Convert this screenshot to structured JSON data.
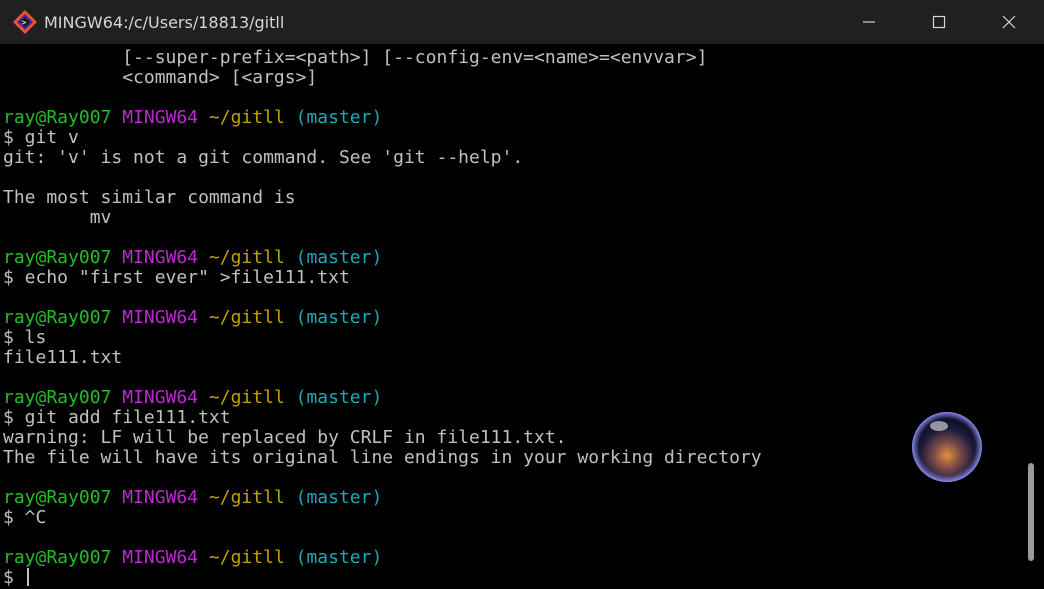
{
  "window": {
    "title": "MINGW64:/c/Users/18813/gitll",
    "icon": "git-bash-icon",
    "controls": [
      "minimize-icon",
      "maximize-icon",
      "close-icon"
    ]
  },
  "terminal": {
    "lines": [
      {
        "type": "text",
        "text": "           [--super-prefix=<path>] [--config-env=<name>=<envvar>]"
      },
      {
        "type": "text",
        "text": "           <command> [<args>]"
      },
      {
        "type": "text",
        "text": ""
      },
      {
        "type": "prompt",
        "user": "ray@Ray007",
        "host": "MINGW64",
        "path": "~/gitll",
        "branch": "(master)"
      },
      {
        "type": "text",
        "text": "$ git v"
      },
      {
        "type": "text",
        "text": "git: 'v' is not a git command. See 'git --help'."
      },
      {
        "type": "text",
        "text": ""
      },
      {
        "type": "text",
        "text": "The most similar command is"
      },
      {
        "type": "text",
        "text": "        mv"
      },
      {
        "type": "text",
        "text": ""
      },
      {
        "type": "prompt",
        "user": "ray@Ray007",
        "host": "MINGW64",
        "path": "~/gitll",
        "branch": "(master)"
      },
      {
        "type": "text",
        "text": "$ echo \"first ever\" >file111.txt"
      },
      {
        "type": "text",
        "text": ""
      },
      {
        "type": "prompt",
        "user": "ray@Ray007",
        "host": "MINGW64",
        "path": "~/gitll",
        "branch": "(master)"
      },
      {
        "type": "text",
        "text": "$ ls"
      },
      {
        "type": "text",
        "text": "file111.txt"
      },
      {
        "type": "text",
        "text": ""
      },
      {
        "type": "prompt",
        "user": "ray@Ray007",
        "host": "MINGW64",
        "path": "~/gitll",
        "branch": "(master)"
      },
      {
        "type": "text",
        "text": "$ git add file111.txt"
      },
      {
        "type": "text",
        "text": "warning: LF will be replaced by CRLF in file111.txt."
      },
      {
        "type": "text",
        "text": "The file will have its original line endings in your working directory"
      },
      {
        "type": "text",
        "text": ""
      },
      {
        "type": "prompt",
        "user": "ray@Ray007",
        "host": "MINGW64",
        "path": "~/gitll",
        "branch": "(master)"
      },
      {
        "type": "text",
        "text": "$ ^C"
      },
      {
        "type": "text",
        "text": ""
      },
      {
        "type": "prompt",
        "user": "ray@Ray007",
        "host": "MINGW64",
        "path": "~/gitll",
        "branch": "(master)"
      },
      {
        "type": "input",
        "text": "$ "
      }
    ]
  },
  "colors": {
    "titlebar": "#202020",
    "background": "#000000",
    "text": "#c0c0c0",
    "user": "#25bc24",
    "host": "#c026d3",
    "path": "#c4a000",
    "branch": "#1ea7b8"
  },
  "overlay": {
    "icon": "floating-orb-icon"
  }
}
